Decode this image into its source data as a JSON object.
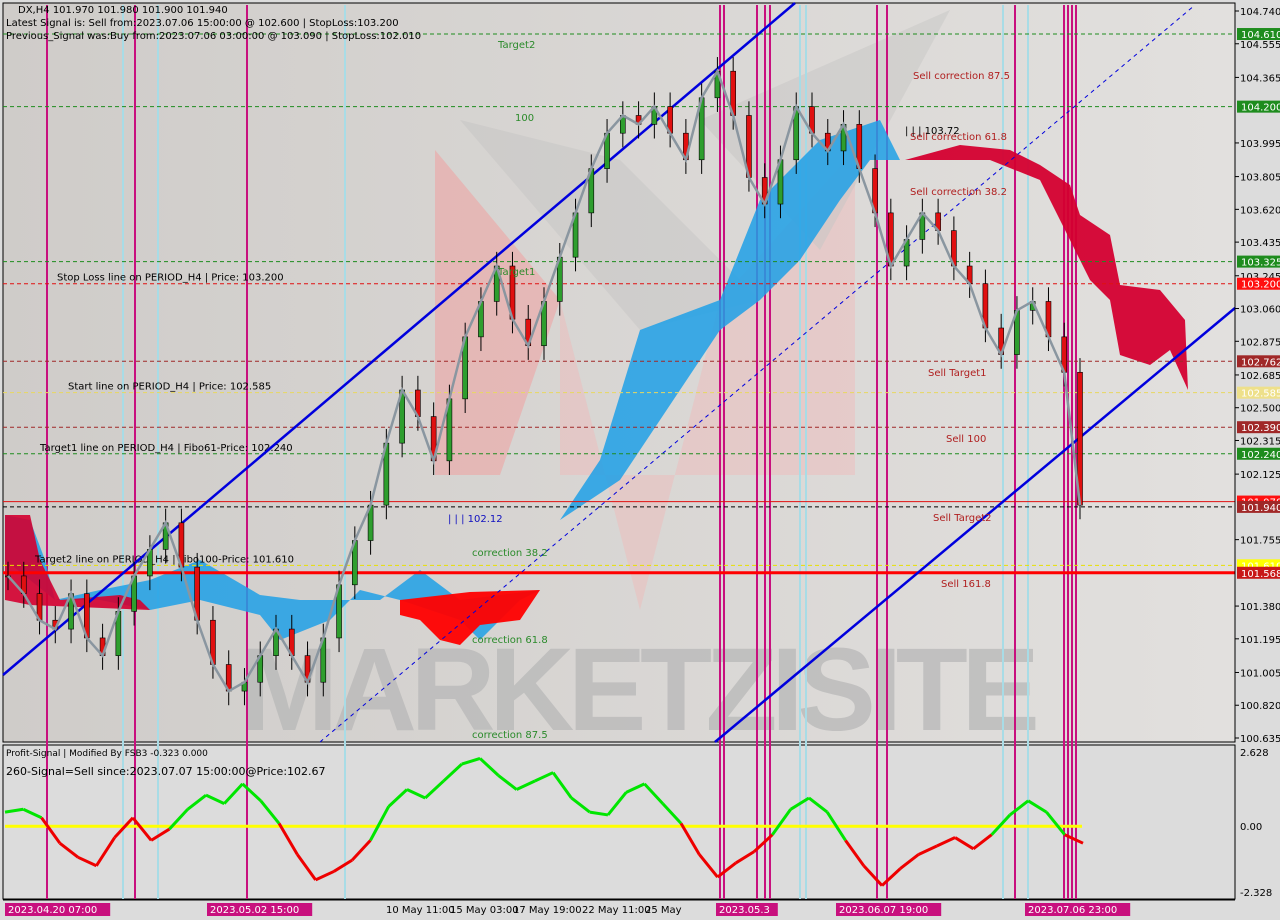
{
  "header": {
    "symbol": "DX,H4",
    "ohlc": "101.970 101.980 101.900 101.940",
    "latest_signal": "Latest Signal is: Sell from:2023.07.06 15:00:00 @ 102.600 | StopLoss:103.200",
    "previous_signal": "Previous_Signal was:Buy from:2023.07.06 03:00:00 @ 103.090 | StopLoss:102.010"
  },
  "indicator": {
    "title": "Profit-Signal | Modified By FSB3 -0.323 0.000",
    "signal": "260-Signal=Sell since:2023.07.07 15:00:00@Price:102.67"
  },
  "watermark": "MARKETZISITE",
  "colors": {
    "background": "#d4d2d0",
    "bull_candle": "#2e9e2e",
    "bear_candle": "#e01010",
    "channel": "#0000dd",
    "cloud_bull": "#1ea0e6",
    "cloud_bear": "#d40030",
    "vline_magenta": "#c8107e",
    "vline_cyan": "#a8dce6",
    "osc_up": "#00e600",
    "osc_down": "#ee0000",
    "osc_zero": "#ffff00"
  },
  "chart_data": [
    {
      "type": "candlestick",
      "title": "DX,H4",
      "ylim": [
        100.635,
        104.74
      ],
      "y_ticks": [
        "104.740",
        "104.555",
        "104.365",
        "103.995",
        "103.805",
        "103.620",
        "103.435",
        "103.245",
        "103.060",
        "102.875",
        "102.685",
        "102.500",
        "102.315",
        "102.125",
        "101.755",
        "101.380",
        "101.195",
        "101.005",
        "100.820",
        "100.635"
      ],
      "x_ticks": [
        "2023.04.20 07:00",
        "2023.05.02 15:00",
        "10 May 11:00",
        "15 May 03:00",
        "17 May 19:00",
        "22 May 11:00",
        "25 May",
        "2023.05.3",
        "2023.06.07 19:00",
        "2023.07.06 23:00"
      ],
      "price_tags": [
        {
          "value": "104.610",
          "color": "#1e8c1e"
        },
        {
          "value": "104.200",
          "color": "#1e8c1e"
        },
        {
          "value": "103.325",
          "color": "#1e8c1e"
        },
        {
          "value": "103.200",
          "color": "#ff1010"
        },
        {
          "value": "102.762",
          "color": "#a02828"
        },
        {
          "value": "102.585",
          "color": "#eee08a"
        },
        {
          "value": "102.390",
          "color": "#a02828"
        },
        {
          "value": "102.240",
          "color": "#1e8c1e"
        },
        {
          "value": "101.970",
          "color": "#ff1010"
        },
        {
          "value": "101.940",
          "color": "#a02828"
        },
        {
          "value": "101.610",
          "color": "#ffff00"
        },
        {
          "value": "101.568",
          "color": "#c81818"
        }
      ],
      "horizontal_lines": [
        {
          "price": 104.61,
          "label": "Target2",
          "color": "#1e8c1e",
          "style": "dashed"
        },
        {
          "price": 104.2,
          "label": "100",
          "color": "#1e8c1e",
          "style": "dashed"
        },
        {
          "price": 103.325,
          "label": "Target1",
          "color": "#1e8c1e",
          "style": "dashed"
        },
        {
          "price": 103.2,
          "label": "Stop Loss line on PERIOD_H4 | Price: 103.200",
          "color": "#e01010",
          "style": "dashed"
        },
        {
          "price": 102.762,
          "label": "",
          "color": "#a02828",
          "style": "dashed"
        },
        {
          "price": 102.585,
          "label": "Start line on PERIOD_H4 | Price: 102.585",
          "color": "#e8d860",
          "style": "dashed"
        },
        {
          "price": 102.39,
          "label": "",
          "color": "#a02828",
          "style": "dashed"
        },
        {
          "price": 102.24,
          "label": "Target1 line on PERIOD_H4 | Fibo61-Price: 102.240",
          "color": "#1e8c1e",
          "style": "dashed"
        },
        {
          "price": 101.97,
          "label": "",
          "color": "#e01010",
          "style": "solid"
        },
        {
          "price": 101.94,
          "label": "",
          "color": "#000000",
          "style": "dashed"
        },
        {
          "price": 101.61,
          "label": "Target2 line on PERIOD_H4 | Fibo100-Price: 101.610",
          "color": "#e8e000",
          "style": "dashed"
        },
        {
          "price": 101.568,
          "label": "",
          "color": "#ff0000",
          "style": "solid-thick"
        }
      ],
      "annotations": [
        {
          "text": "Target2",
          "color": "#2a8a2a"
        },
        {
          "text": "100",
          "color": "#2a8a2a"
        },
        {
          "text": "Target1",
          "color": "#2a8a2a"
        },
        {
          "text": "correction 38.2",
          "color": "#2a8a2a"
        },
        {
          "text": "correction 61.8",
          "color": "#2a8a2a"
        },
        {
          "text": "correction 87.5",
          "color": "#2a8a2a"
        },
        {
          "text": "Sell correction 87.5",
          "color": "#b02020"
        },
        {
          "text": "Sell correction 61.8",
          "color": "#b02020"
        },
        {
          "text": "Sell correction 38.2",
          "color": "#b02020"
        },
        {
          "text": "Sell Target1",
          "color": "#b02020"
        },
        {
          "text": "Sell 100",
          "color": "#b02020"
        },
        {
          "text": "Sell Target2",
          "color": "#b02020"
        },
        {
          "text": "Sell 161.8",
          "color": "#b02020"
        },
        {
          "text": "| | | 102.12",
          "color": "#1010c0"
        },
        {
          "text": "| | | 103.72",
          "color": "#000000"
        }
      ],
      "close_path": [
        101.55,
        101.45,
        101.3,
        101.25,
        101.45,
        101.2,
        101.1,
        101.35,
        101.55,
        101.7,
        101.85,
        101.6,
        101.3,
        101.05,
        100.9,
        100.95,
        101.1,
        101.25,
        101.1,
        100.95,
        101.2,
        101.5,
        101.75,
        101.95,
        102.3,
        102.6,
        102.45,
        102.2,
        102.55,
        102.9,
        103.1,
        103.3,
        103.0,
        102.85,
        103.1,
        103.35,
        103.6,
        103.85,
        104.05,
        104.15,
        104.1,
        104.2,
        104.05,
        103.9,
        104.25,
        104.4,
        104.15,
        103.8,
        103.65,
        103.9,
        104.2,
        104.05,
        103.95,
        104.1,
        103.85,
        103.6,
        103.3,
        103.45,
        103.6,
        103.5,
        103.3,
        103.2,
        102.95,
        102.8,
        103.05,
        103.1,
        102.9,
        102.7,
        101.95
      ]
    },
    {
      "type": "line",
      "title": "Profit-Signal | Modified By FSB3 -0.323 0.000",
      "ylim": [
        -2.328,
        2.628
      ],
      "y_ticks": [
        "2.628",
        "0.00",
        "-2.328"
      ],
      "values": [
        0.5,
        0.6,
        0.3,
        -0.6,
        -1.1,
        -1.4,
        -0.4,
        0.3,
        -0.5,
        -0.1,
        0.6,
        1.1,
        0.8,
        1.5,
        0.9,
        0.1,
        -1.0,
        -1.9,
        -1.6,
        -1.2,
        -0.5,
        0.7,
        1.3,
        1.0,
        1.6,
        2.2,
        2.4,
        1.8,
        1.3,
        1.6,
        1.9,
        1.0,
        0.5,
        0.4,
        1.2,
        1.5,
        0.8,
        0.1,
        -1.0,
        -1.8,
        -1.3,
        -0.9,
        -0.3,
        0.6,
        1.0,
        0.5,
        -0.5,
        -1.4,
        -2.1,
        -1.5,
        -1.0,
        -0.7,
        -0.4,
        -0.8,
        -0.3,
        0.4,
        0.9,
        0.5,
        -0.3,
        -0.6
      ]
    }
  ]
}
